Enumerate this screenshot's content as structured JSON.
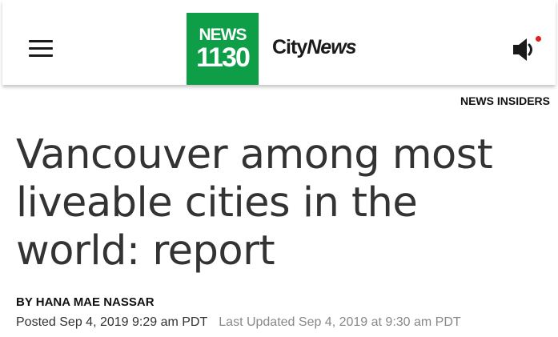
{
  "header": {
    "logo_line1": "NEWS",
    "logo_line2": "1130",
    "brand_city": "City",
    "brand_news": "News",
    "notification_color": "#e0211e",
    "logo_color": "#0f9e48"
  },
  "article": {
    "section": "NEWS INSIDERS",
    "title": "Vancouver among most liveable cities in the world: report",
    "byline_prefix": "BY",
    "author": "HANA MAE NASSAR",
    "posted": "Posted Sep 4, 2019 9:29 am PDT",
    "updated": "Last Updated Sep 4, 2019 at 9:30 am PDT"
  },
  "icons": {
    "menu": "hamburger-menu-icon",
    "sound": "speaker-icon"
  }
}
